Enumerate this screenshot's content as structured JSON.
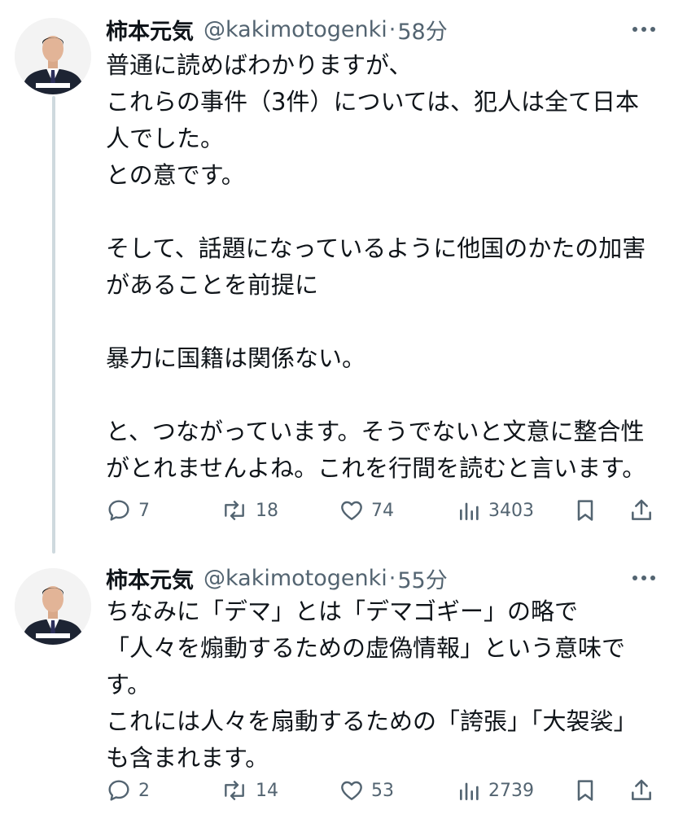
{
  "tweets": [
    {
      "author": {
        "name": "柿本元気",
        "handle": "@kakimotogenki",
        "separator": "·",
        "time": "58分"
      },
      "text": "普通に読めばわかりますが、\nこれらの事件（3件）については、犯人は全て日本人でした。\nとの意です。\n\nそして、話題になっているように他国のかたの加害があることを前提に\n\n暴力に国籍は関係ない。\n\nと、つながっています。そうでないと文意に整合性がとれませんよね。これを行間を読むと言います。",
      "stats": {
        "replies": "7",
        "retweets": "18",
        "likes": "74",
        "views": "3403"
      }
    },
    {
      "author": {
        "name": "柿本元気",
        "handle": "@kakimotogenki",
        "separator": "·",
        "time": "55分"
      },
      "text": "ちなみに「デマ」とは「デマゴギー」の略で\n「人々を煽動するための虚偽情報」という意味です。\nこれには人々を扇動するための「誇張」「大袈裟」も含まれます。",
      "stats": {
        "replies": "2",
        "retweets": "14",
        "likes": "53",
        "views": "2739"
      }
    }
  ],
  "icons": {
    "more": "more-icon",
    "reply": "reply-icon",
    "retweet": "retweet-icon",
    "like": "heart-icon",
    "views": "views-icon",
    "bookmark": "bookmark-icon",
    "share": "share-icon"
  },
  "colors": {
    "text": "#0f1419",
    "secondary": "#536471",
    "thread_line": "#cfd9de",
    "background": "#ffffff"
  }
}
